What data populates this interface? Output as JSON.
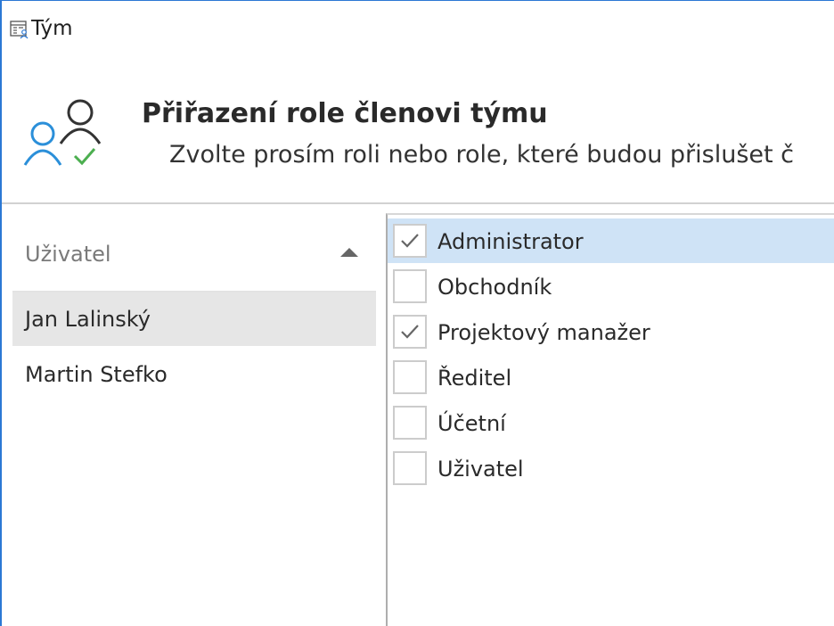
{
  "window": {
    "title": "Tým",
    "title_icon": "team-list-icon",
    "accent_color": "#2b78d4"
  },
  "header": {
    "icon": "users-check-icon",
    "title": "Přiřazení role členovi týmu",
    "subtitle": "Zvolte prosím roli nebo role, které budou přislušet č"
  },
  "users": {
    "column_header": "Uživatel",
    "sort": "ascending",
    "items": [
      {
        "name": "Jan Lalinský",
        "selected": true
      },
      {
        "name": "Martin Stefko",
        "selected": false
      }
    ]
  },
  "roles": {
    "items": [
      {
        "label": "Administrator",
        "checked": true,
        "highlighted": true
      },
      {
        "label": "Obchodník",
        "checked": false,
        "highlighted": false
      },
      {
        "label": "Projektový manažer",
        "checked": true,
        "highlighted": false
      },
      {
        "label": "Ředitel",
        "checked": false,
        "highlighted": false
      },
      {
        "label": "Účetní",
        "checked": false,
        "highlighted": false
      },
      {
        "label": "Uživatel",
        "checked": false,
        "highlighted": false
      }
    ],
    "highlight_color": "#cfe3f6"
  }
}
